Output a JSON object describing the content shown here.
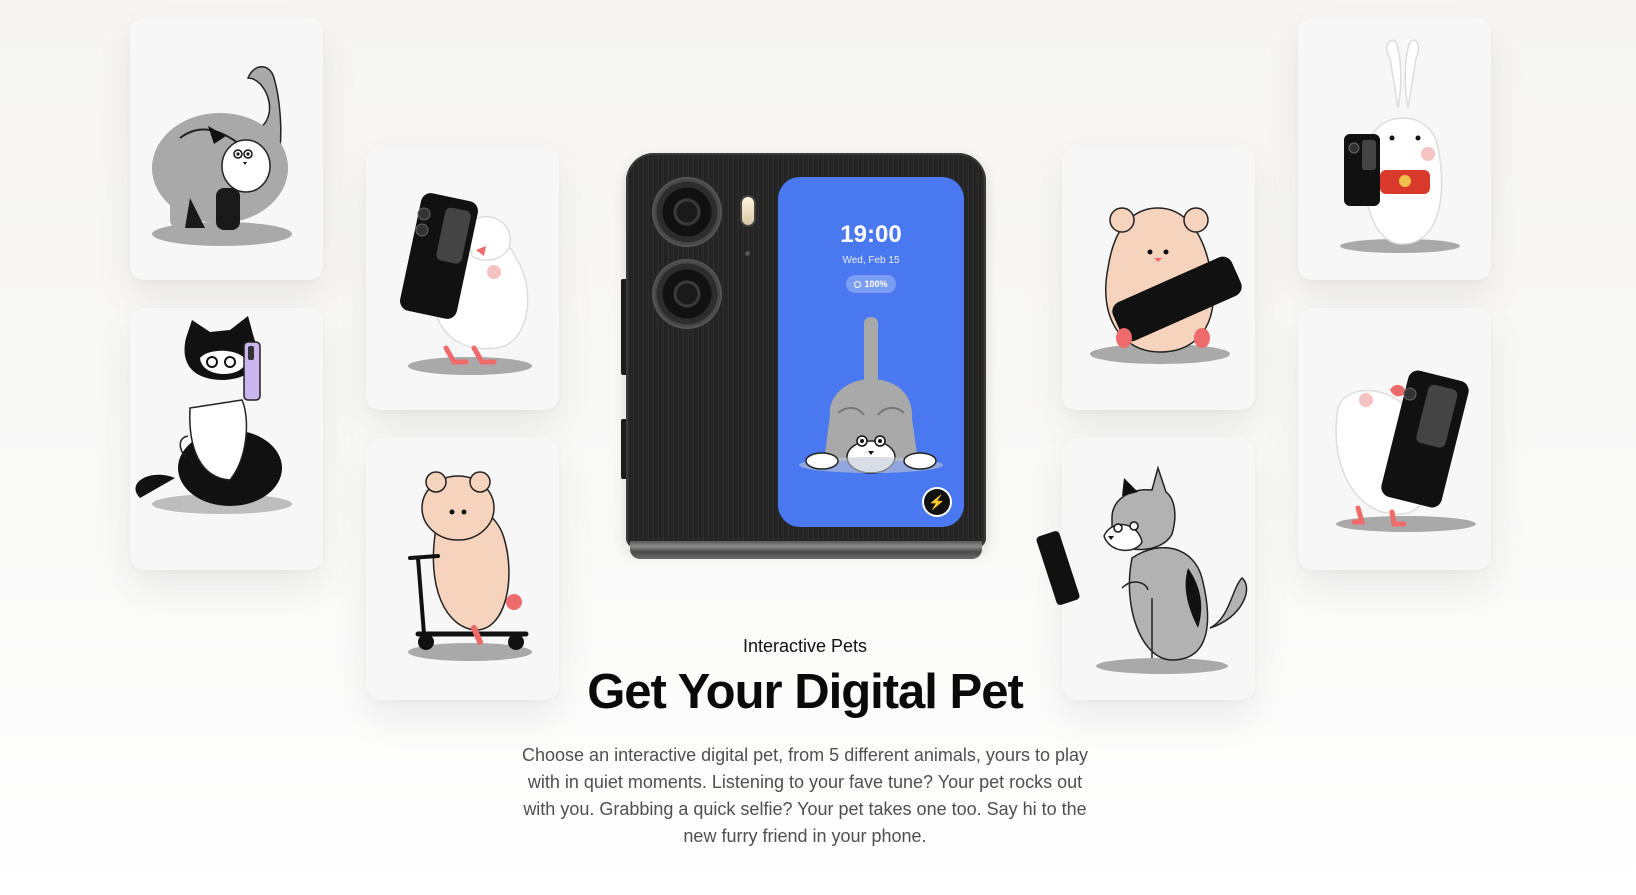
{
  "section": {
    "eyebrow": "Interactive Pets",
    "headline": "Get Your Digital Pet",
    "body": "Choose an interactive digital pet, from 5 different animals, yours to play with in quiet moments. Listening to your fave tune? Your pet rocks out with you. Grabbing a quick selfie? Your pet takes one too. Say hi to the new furry friend in your phone."
  },
  "phone": {
    "cover_screen": {
      "time": "19:00",
      "date": "Wed, Feb 15",
      "battery": "100%",
      "pet": "grey cat peeking"
    }
  },
  "pet_cards": [
    {
      "pet": "grey cat stretching"
    },
    {
      "pet": "black and white cat with phone"
    },
    {
      "pet": "white bird holding flip phone"
    },
    {
      "pet": "hamster on scooter"
    },
    {
      "pet": "hamster holding flip phone"
    },
    {
      "pet": "grey dog reading phone"
    },
    {
      "pet": "white rabbit with phone"
    },
    {
      "pet": "white bird hugging flip phone"
    }
  ],
  "colors": {
    "screen_blue": "#4a78f0",
    "phone_black": "#262626",
    "card_bg": "#f7f7f7",
    "accent_red": "#ef6a6a",
    "hamster_peach": "#f6d3bd",
    "cat_grey": "#a9a9a9"
  }
}
